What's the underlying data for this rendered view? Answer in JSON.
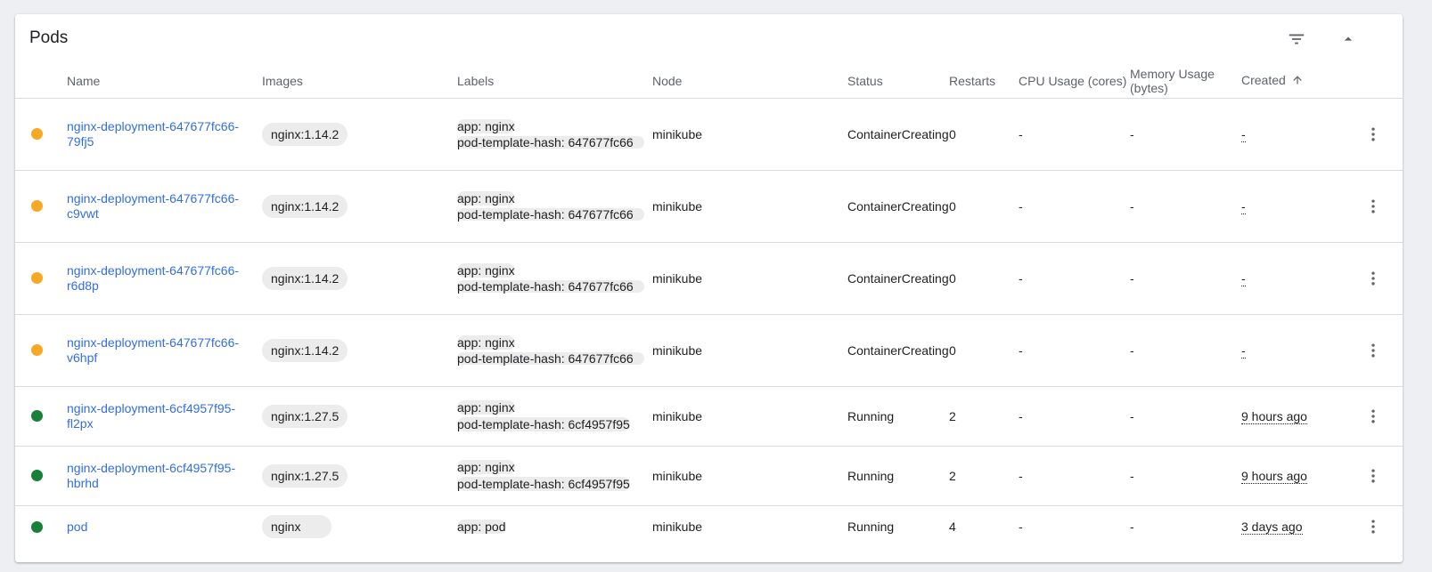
{
  "card": {
    "title": "Pods",
    "filter_icon": "filter-icon",
    "collapse_icon": "chevron-up-icon"
  },
  "columns": {
    "name": "Name",
    "images": "Images",
    "labels": "Labels",
    "node": "Node",
    "status": "Status",
    "restarts": "Restarts",
    "cpu": "CPU Usage (cores)",
    "memory": "Memory Usage (bytes)",
    "created": "Created",
    "created_sort_icon": "arrow-up-icon"
  },
  "colors": {
    "pending": "#f9a825",
    "running": "#188038",
    "link": "#326de6"
  },
  "rows": [
    {
      "status_state": "pending",
      "name": "nginx-deployment-647677fc66-79fj5",
      "image": "nginx:1.14.2",
      "labels": [
        "app: nginx",
        "pod-template-hash: 647677fc66"
      ],
      "node": "minikube",
      "status": "ContainerCreating",
      "restarts": "0",
      "cpu": "-",
      "memory": "-",
      "created": "-"
    },
    {
      "status_state": "pending",
      "name": "nginx-deployment-647677fc66-c9vwt",
      "image": "nginx:1.14.2",
      "labels": [
        "app: nginx",
        "pod-template-hash: 647677fc66"
      ],
      "node": "minikube",
      "status": "ContainerCreating",
      "restarts": "0",
      "cpu": "-",
      "memory": "-",
      "created": "-"
    },
    {
      "status_state": "pending",
      "name": "nginx-deployment-647677fc66-r6d8p",
      "image": "nginx:1.14.2",
      "labels": [
        "app: nginx",
        "pod-template-hash: 647677fc66"
      ],
      "node": "minikube",
      "status": "ContainerCreating",
      "restarts": "0",
      "cpu": "-",
      "memory": "-",
      "created": "-"
    },
    {
      "status_state": "pending",
      "name": "nginx-deployment-647677fc66-v6hpf",
      "image": "nginx:1.14.2",
      "labels": [
        "app: nginx",
        "pod-template-hash: 647677fc66"
      ],
      "node": "minikube",
      "status": "ContainerCreating",
      "restarts": "0",
      "cpu": "-",
      "memory": "-",
      "created": "-"
    },
    {
      "status_state": "running",
      "name": "nginx-deployment-6cf4957f95-fl2px",
      "image": "nginx:1.27.5",
      "labels": [
        "app: nginx",
        "pod-template-hash: 6cf4957f95"
      ],
      "node": "minikube",
      "status": "Running",
      "restarts": "2",
      "cpu": "-",
      "memory": "-",
      "created": "9 hours ago"
    },
    {
      "status_state": "running",
      "name": "nginx-deployment-6cf4957f95-hbrhd",
      "image": "nginx:1.27.5",
      "labels": [
        "app: nginx",
        "pod-template-hash: 6cf4957f95"
      ],
      "node": "minikube",
      "status": "Running",
      "restarts": "2",
      "cpu": "-",
      "memory": "-",
      "created": "9 hours ago"
    },
    {
      "status_state": "running",
      "name": "pod",
      "image": "nginx",
      "labels": [
        "app: pod"
      ],
      "node": "minikube",
      "status": "Running",
      "restarts": "4",
      "cpu": "-",
      "memory": "-",
      "created": "3 days ago"
    }
  ]
}
